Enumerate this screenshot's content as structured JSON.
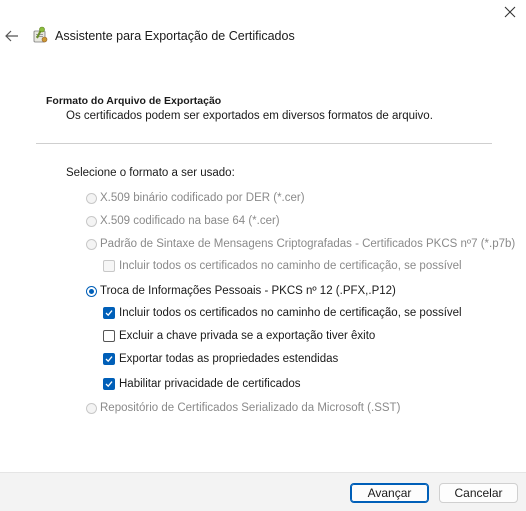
{
  "window": {
    "title": "Assistente para Exportação de Certificados",
    "close_icon": "close-icon",
    "back_icon": "back-arrow-icon",
    "wizard_icon": "certificate-wizard-icon"
  },
  "header": {
    "section_title": "Formato do Arquivo de Exportação",
    "section_subtitle": "Os certificados podem ser exportados em diversos formatos de arquivo."
  },
  "form": {
    "select_label": "Selecione o formato a ser usado:",
    "radio_options": [
      {
        "label": "X.509 binário codificado por DER (*.cer)",
        "enabled": false,
        "selected": false
      },
      {
        "label": "X.509 codificado na base 64 (*.cer)",
        "enabled": false,
        "selected": false
      },
      {
        "label": "Padrão de Sintaxe de Mensagens Criptografadas - Certificados PKCS nº7 (*.p7b)",
        "enabled": false,
        "selected": false
      },
      {
        "label": "Troca de Informações Pessoais - PKCS nº 12 (.PFX,.P12)",
        "enabled": true,
        "selected": true
      },
      {
        "label": "Repositório de Certificados Serializado da Microsoft (.SST)",
        "enabled": false,
        "selected": false
      }
    ],
    "p7b_include_chain": {
      "label": "Incluir todos os certificados no caminho de certificação, se possível",
      "enabled": false,
      "checked": false
    },
    "pfx_options": [
      {
        "label": "Incluir todos os certificados no caminho de certificação, se possível",
        "checked": true
      },
      {
        "label": "Excluir a chave privada se a exportação tiver êxito",
        "checked": false
      },
      {
        "label": "Exportar todas as propriedades estendidas",
        "checked": true
      },
      {
        "label": "Habilitar privacidade de certificados",
        "checked": true
      }
    ]
  },
  "footer": {
    "next_label": "Avançar",
    "cancel_label": "Cancelar"
  },
  "colors": {
    "accent": "#005fb8",
    "disabled_text": "#8a8a8a",
    "footer_bg": "#f3f3f3"
  }
}
